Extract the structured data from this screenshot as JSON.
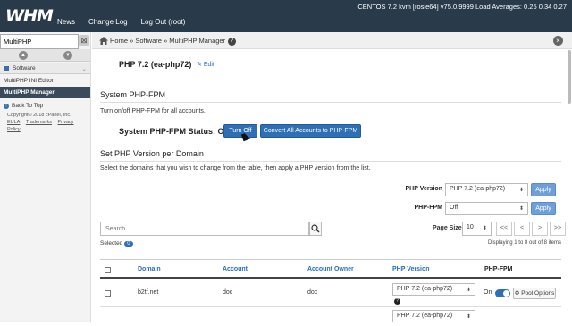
{
  "topbar": {
    "logo": "WHM",
    "nav": [
      "News",
      "Change Log",
      "Log Out (root)"
    ],
    "sysinfo": "CENTOS 7.2 kvm [rosie64]   v75.0.9999   Load Averages: 0.25 0.34 0.27"
  },
  "sidebar": {
    "search_value": "MultiPHP",
    "clear_label": "⊠",
    "section": "Software",
    "items": [
      "MultiPHP INI Editor",
      "MultiPHP Manager"
    ],
    "back_to_top": "Back To Top",
    "copyright": "Copyright© 2018 cPanel, Inc.",
    "links": [
      "EULA",
      "Trademarks",
      "Privacy Policy"
    ]
  },
  "breadcrumb": {
    "path": "Home » Software » MultiPHP Manager",
    "help": "?"
  },
  "main": {
    "php_version_title": "PHP 7.2 (ea-php72)",
    "edit_label": "Edit",
    "fpm_heading": "System PHP-FPM",
    "fpm_text": "Turn on/off PHP-FPM for all accounts.",
    "fpm_status": "System PHP-FPM Status: On",
    "turn_off_label": "Turn Off",
    "convert_label": "Convert All Accounts to PHP-FPM",
    "setver_heading": "Set PHP Version per Domain",
    "setver_text": "Select the domains that you wish to change from the table, then apply a PHP version from the list.",
    "php_version_label": "PHP Version",
    "php_version_value": "PHP 7.2 (ea-php72)",
    "php_fpm_label": "PHP-FPM",
    "php_fpm_value": "Off",
    "apply_label": "Apply",
    "search_placeholder": "Search",
    "page_size_label": "Page Size",
    "page_size_value": "10",
    "pager": [
      "<<",
      "<",
      ">",
      ">>"
    ],
    "selected_label": "Selected",
    "selected_count": "0",
    "displaying": "Displaying 1 to 8 out of 8 items"
  },
  "table": {
    "headers": [
      "Domain",
      "Account",
      "Account Owner",
      "PHP Version",
      "PHP-FPM"
    ],
    "rows": [
      {
        "domain": "b2tf.net",
        "account": "doc",
        "owner": "doc",
        "php": "PHP 7.2 (ea-php72)",
        "fpm": "On",
        "pool": "Pool Options"
      },
      {
        "php": "PHP 7.2 (ea-php72)"
      }
    ]
  },
  "colors": {
    "topbar": "#293a4a",
    "accent": "#2e6fb6",
    "link": "#2a6ebb"
  }
}
